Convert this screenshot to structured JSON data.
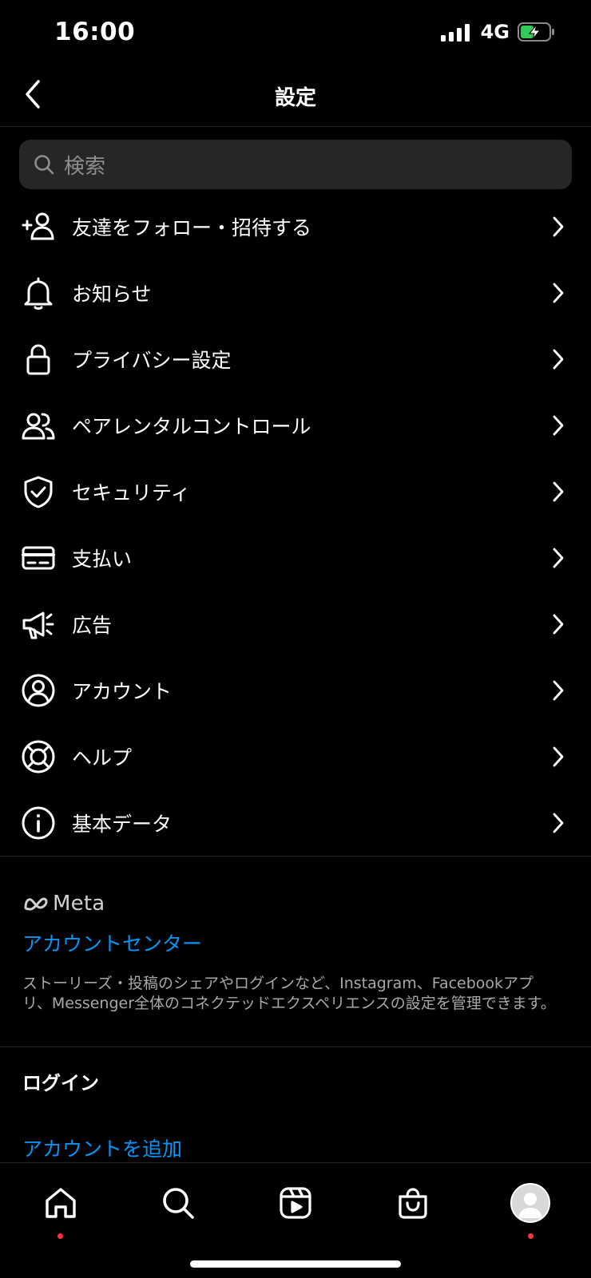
{
  "status": {
    "time": "16:00",
    "network": "4G"
  },
  "header": {
    "title": "設定"
  },
  "search": {
    "placeholder": "検索"
  },
  "menu": [
    {
      "label": "友達をフォロー・招待する",
      "icon": "add-person-icon"
    },
    {
      "label": "お知らせ",
      "icon": "bell-icon"
    },
    {
      "label": "プライバシー設定",
      "icon": "lock-icon"
    },
    {
      "label": "ペアレンタルコントロール",
      "icon": "people-icon"
    },
    {
      "label": "セキュリティ",
      "icon": "shield-check-icon"
    },
    {
      "label": "支払い",
      "icon": "card-icon"
    },
    {
      "label": "広告",
      "icon": "megaphone-icon"
    },
    {
      "label": "アカウント",
      "icon": "account-circle-icon"
    },
    {
      "label": "ヘルプ",
      "icon": "lifebuoy-icon"
    },
    {
      "label": "基本データ",
      "icon": "info-icon"
    }
  ],
  "meta": {
    "logo": "Meta",
    "account_center": "アカウントセンター",
    "description": "ストーリーズ・投稿のシェアやログインなど、Instagram、Facebookアプリ、Messenger全体のコネクテッドエクスペリエンスの設定を管理できます。"
  },
  "login": {
    "header": "ログイン",
    "add_account": "アカウントを追加"
  },
  "tabs": [
    "home-icon",
    "search-icon",
    "reels-icon",
    "shop-icon",
    "profile-avatar"
  ],
  "colors": {
    "background": "#000000",
    "link": "#0095f6",
    "badge": "#ff3040",
    "battery": "#34c759"
  }
}
